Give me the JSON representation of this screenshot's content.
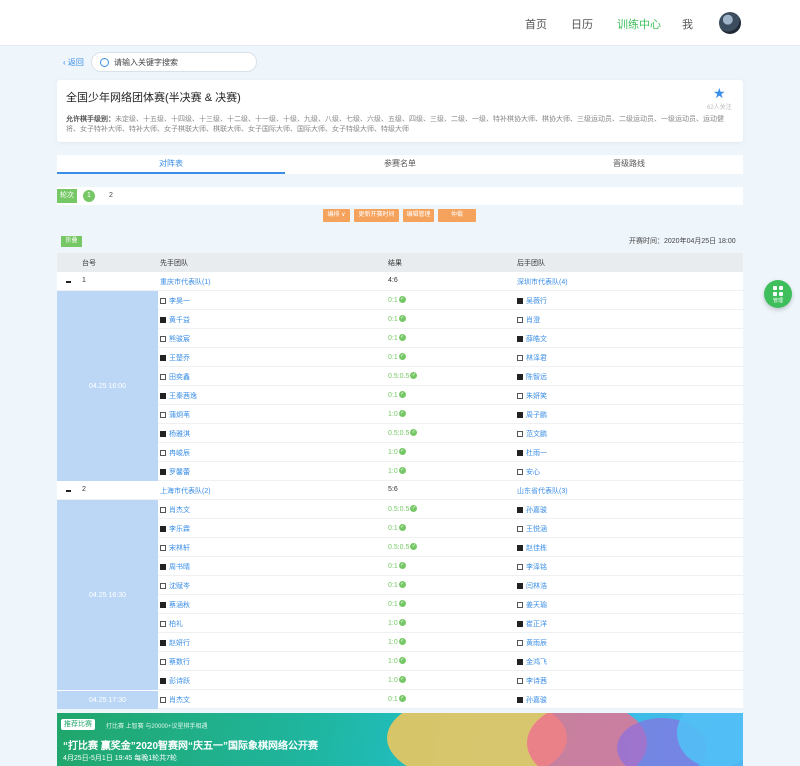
{
  "nav": {
    "items": [
      {
        "label": "首页",
        "active": false
      },
      {
        "label": "日历",
        "active": false
      },
      {
        "label": "训练中心",
        "active": true
      },
      {
        "label": "我",
        "active": false
      }
    ]
  },
  "search": {
    "back_label": "返回",
    "placeholder": "请输入关键字搜索"
  },
  "event": {
    "title": "全国少年网络团体赛(半决赛 & 决赛)",
    "follow_count": "62人关注",
    "levels_label": "允许棋手级别：",
    "levels_text": "未定级、十五级、十四级、十三级、十二级、十一级、十级、九级、八级、七级、六级、五级、四级、三级、二级、一级、特补棋协大师、棋协大师、三级运动员、二级运动员、一级运动员、运动健将、女子特补大师、特补大师、女子棋联大师、棋联大师、女子国际大师、国际大师、女子特级大师、特级大师"
  },
  "tabs": [
    "对阵表",
    "参赛名单",
    "晋级路线"
  ],
  "rounds": {
    "label": "轮次",
    "items": [
      "1",
      "2"
    ],
    "active": "1"
  },
  "actions": [
    "编排 ∨",
    "更新开赛时间",
    "编辑管理",
    "仲裁"
  ],
  "collapse_label": "折叠",
  "start_time": "开赛时间：2020年04月25日 18:00",
  "table": {
    "headers": [
      "台号",
      "先手团队",
      "结果",
      "后手团队"
    ],
    "groups": [
      {
        "no": "1",
        "home": "重庆市代表队(1)",
        "score": "4:6",
        "away": "深圳市代表队(4)",
        "times": [
          {
            "label": "04.25 16:00",
            "rows": 10
          }
        ],
        "rows": [
          {
            "home": "李昊一",
            "home_color": "white",
            "result": "0:1",
            "away": "吴薇行",
            "away_color": "black"
          },
          {
            "home": "黄千益",
            "home_color": "black",
            "result": "0:1",
            "away": "肖澄",
            "away_color": "white"
          },
          {
            "home": "熊骏宸",
            "home_color": "white",
            "result": "0:1",
            "away": "薛皓文",
            "away_color": "black"
          },
          {
            "home": "王楚乔",
            "home_color": "black",
            "result": "0:1",
            "away": "林泽君",
            "away_color": "white"
          },
          {
            "home": "田奕鑫",
            "home_color": "white",
            "result": "0.5:0.5",
            "away": "陈智远",
            "away_color": "black"
          },
          {
            "home": "王秦茜逸",
            "home_color": "black",
            "result": "0:1",
            "away": "朱妍笑",
            "away_color": "white"
          },
          {
            "home": "蒲炯苇",
            "home_color": "white",
            "result": "1:0",
            "away": "周子鹏",
            "away_color": "black"
          },
          {
            "home": "杨雅淇",
            "home_color": "black",
            "result": "0.5:0.5",
            "away": "范文鹏",
            "away_color": "white"
          },
          {
            "home": "冉峻辰",
            "home_color": "white",
            "result": "1:0",
            "away": "杜雨一",
            "away_color": "black"
          },
          {
            "home": "罗馨蕾",
            "home_color": "black",
            "result": "1:0",
            "away": "安心",
            "away_color": "white"
          }
        ]
      },
      {
        "no": "2",
        "home": "上海市代表队(2)",
        "score": "5:6",
        "away": "山东省代表队(3)",
        "times": [
          {
            "label": "04.25 16:30",
            "rows": 10
          },
          {
            "label": "04.25 17:30",
            "rows": 1
          }
        ],
        "rows": [
          {
            "home": "肖杰文",
            "home_color": "white",
            "result": "0.5:0.5",
            "away": "孙嘉骏",
            "away_color": "black"
          },
          {
            "home": "李乐霖",
            "home_color": "black",
            "result": "0:1",
            "away": "王悦涵",
            "away_color": "white"
          },
          {
            "home": "宋林轩",
            "home_color": "white",
            "result": "0.5:0.5",
            "away": "赵佳栋",
            "away_color": "black"
          },
          {
            "home": "周书晴",
            "home_color": "black",
            "result": "0:1",
            "away": "李泽铭",
            "away_color": "white"
          },
          {
            "home": "沈赋岑",
            "home_color": "white",
            "result": "0:1",
            "away": "闫林浩",
            "away_color": "black"
          },
          {
            "home": "蔡涵秋",
            "home_color": "black",
            "result": "0:1",
            "away": "姜天瑜",
            "away_color": "white"
          },
          {
            "home": "柏礼",
            "home_color": "white",
            "result": "1:0",
            "away": "崔正洋",
            "away_color": "black"
          },
          {
            "home": "赵妍行",
            "home_color": "black",
            "result": "1:0",
            "away": "黄雨辰",
            "away_color": "white"
          },
          {
            "home": "蔡数行",
            "home_color": "white",
            "result": "1:0",
            "away": "金鸿飞",
            "away_color": "black"
          },
          {
            "home": "彭诗跃",
            "home_color": "black",
            "result": "1:0",
            "away": "李诗茜",
            "away_color": "white"
          },
          {
            "home": "肖杰文",
            "home_color": "white",
            "result": "0:1",
            "away": "孙嘉骏",
            "away_color": "black"
          }
        ]
      }
    ]
  },
  "fab": {
    "label": "管理"
  },
  "banner": {
    "tag": "推荐比赛",
    "sub": "打比赛 上智赛 与20000+议星棋手相遇",
    "title": "“打比赛 赢奖金”2020智赛网“庆五一”国际象棋网络公开赛",
    "date": "4月25日-5月1日 19:45 每晚1轮共7轮"
  },
  "colors": {
    "accent_green": "#3fbf5b",
    "accent_blue": "#3a8ee6",
    "action_orange": "#f5a25d",
    "time_cell": "#bcd7f6"
  }
}
